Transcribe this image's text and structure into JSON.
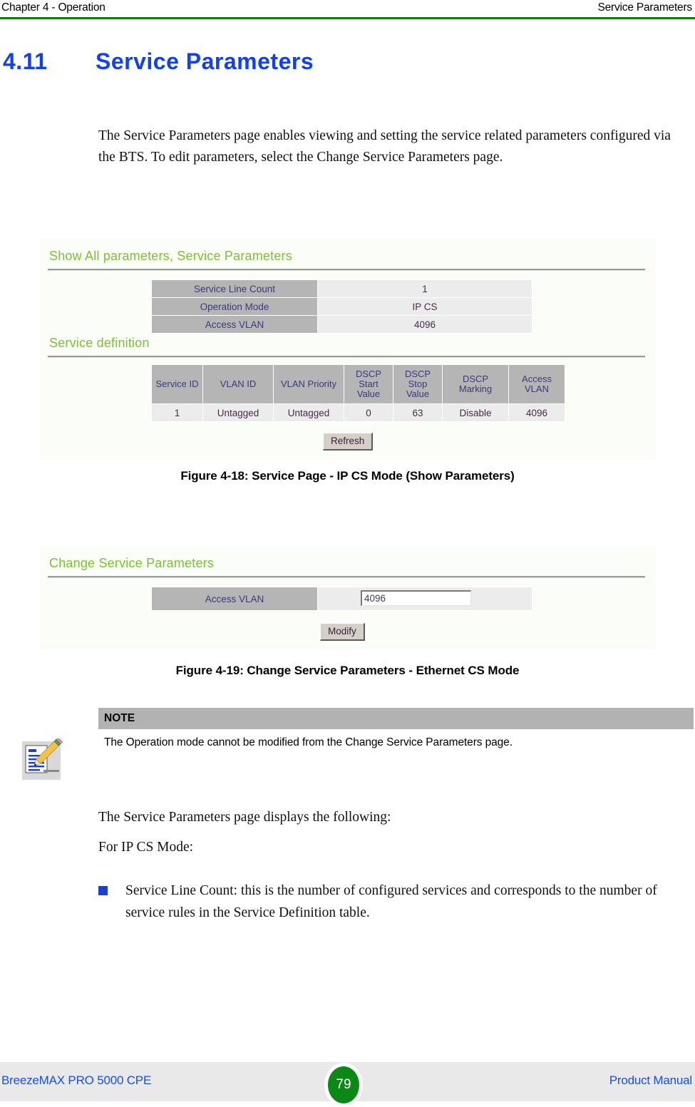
{
  "header": {
    "left": "Chapter 4 - Operation",
    "right": "Service Parameters"
  },
  "section": {
    "number": "4.11",
    "title": "Service Parameters"
  },
  "intro_paragraph": "The Service Parameters page enables viewing and setting the service related parameters configured via the BTS. To edit parameters, select the Change Service Parameters page.",
  "figure_show": {
    "heading_main": "Show All parameters, Service Parameters",
    "heading_definition": "Service definition",
    "summary_rows": [
      {
        "label": "Service Line Count",
        "value": "1"
      },
      {
        "label": "Operation Mode",
        "value": "IP CS"
      },
      {
        "label": "Access VLAN",
        "value": "4096"
      }
    ],
    "definition_columns": [
      "Service ID",
      "VLAN ID",
      "VLAN Priority",
      "DSCP Start Value",
      "DSCP Stop Value",
      "DSCP Marking",
      "Access VLAN"
    ],
    "definition_rows": [
      [
        "1",
        "Untagged",
        "Untagged",
        "0",
        "63",
        "Disable",
        "4096"
      ]
    ],
    "refresh_button": "Refresh",
    "caption": "Figure 4-18: Service Page - IP CS Mode (Show Parameters)"
  },
  "figure_change": {
    "heading": "Change Service Parameters",
    "field_label": "Access VLAN",
    "field_value": "4096",
    "modify_button": "Modify",
    "caption": "Figure 4-19: Change Service Parameters - Ethernet CS Mode"
  },
  "note": {
    "title": "NOTE",
    "text": "The Operation mode cannot be modified from the Change Service Parameters page."
  },
  "displays_paragraph": "The Service Parameters page displays the following:",
  "ipcs_paragraph": "For IP CS Mode:",
  "bullets": [
    "Service Line Count: this is the number of configured services and corresponds to the number of service rules in the Service Definition table."
  ],
  "footer": {
    "left": "BreezeMAX PRO 5000 CPE",
    "page": "79",
    "right": "Product Manual"
  },
  "colors": {
    "header_rule_green": "#008000",
    "section_title_blue": "#1040f0",
    "ui_heading_green": "#7ac32e",
    "bullet_blue": "#1a3fd6",
    "note_band_gray": "#b2b2b2",
    "footer_band_gray": "#e9e9e9",
    "footer_link_blue": "#1a4fe0",
    "page_badge_green": "#0a8a14",
    "table_label_gray": "#b5b5b5",
    "table_value_gray": "#ececec"
  }
}
